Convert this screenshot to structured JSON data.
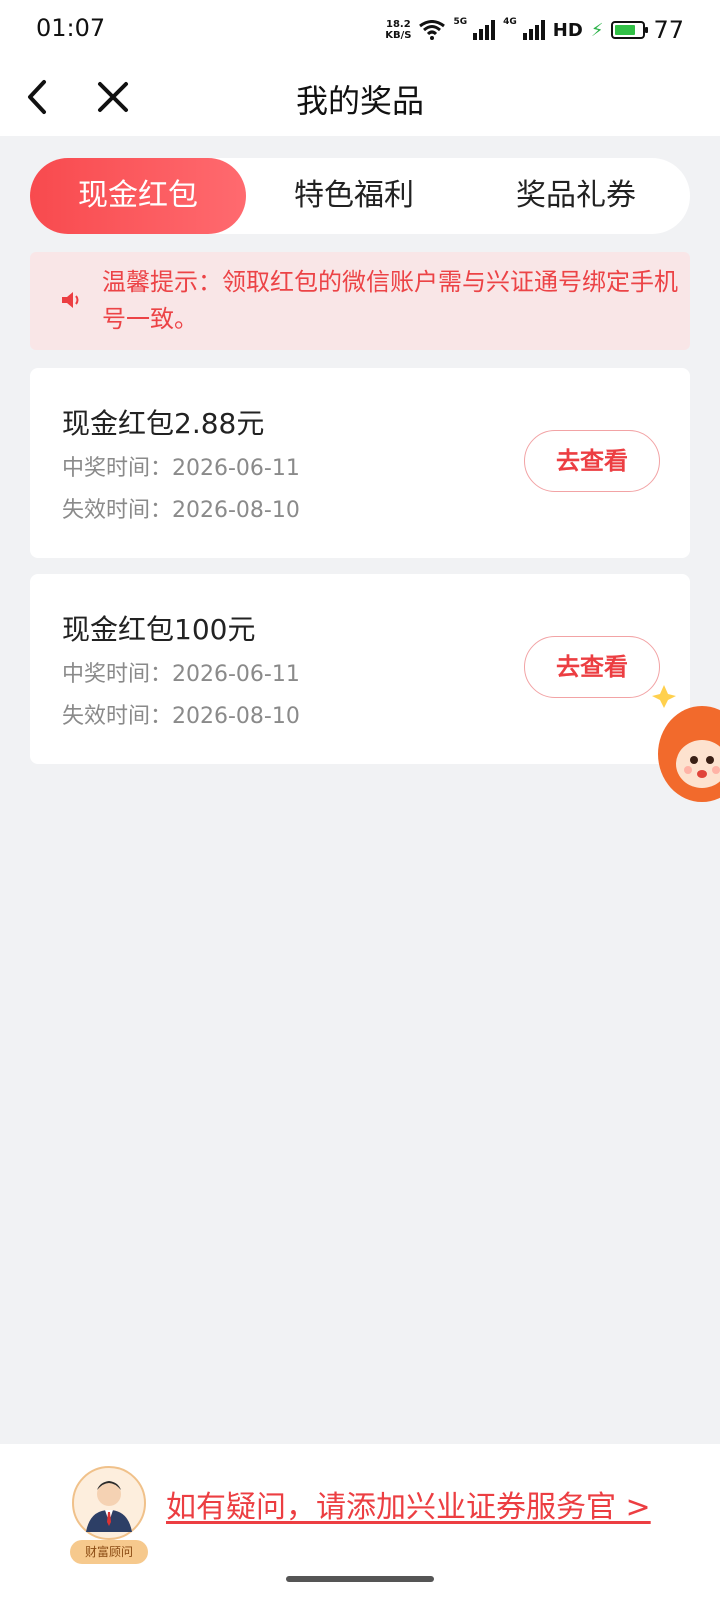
{
  "status_bar": {
    "time": "01:07",
    "net_speed_value": "18.2",
    "net_speed_unit": "KB/S",
    "sim1_label": "5G",
    "sim2_label": "4G",
    "hd_label": "HD",
    "battery_level": 77,
    "battery_text": "77"
  },
  "nav": {
    "title": "我的奖品",
    "back_icon": "back-arrow-icon",
    "close_icon": "close-icon"
  },
  "tabs": [
    {
      "label": "现金红包",
      "active": true
    },
    {
      "label": "特色福利",
      "active": false
    },
    {
      "label": "奖品礼券",
      "active": false
    }
  ],
  "notice": {
    "icon": "speaker-icon",
    "text": "温馨提示：领取红包的微信账户需与兴证通号绑定手机号一致。"
  },
  "prizes": [
    {
      "title": "现金红包2.88元",
      "win_time": "中奖时间：2026-06-11",
      "expire_time": "失效时间：2026-08-10",
      "button": "去查看"
    },
    {
      "title": "现金红包100元",
      "win_time": "中奖时间：2026-06-11",
      "expire_time": "失效时间：2026-08-10",
      "button": "去查看"
    }
  ],
  "footer": {
    "advisor_tag": "财富顾问",
    "link_text": "如有疑问，请添加兴业证券服务官 >"
  },
  "colors": {
    "accent": "#f84a4e",
    "accent_text": "#ec3e42",
    "notice_bg": "#f9e6e7",
    "page_bg": "#f1f2f4"
  }
}
